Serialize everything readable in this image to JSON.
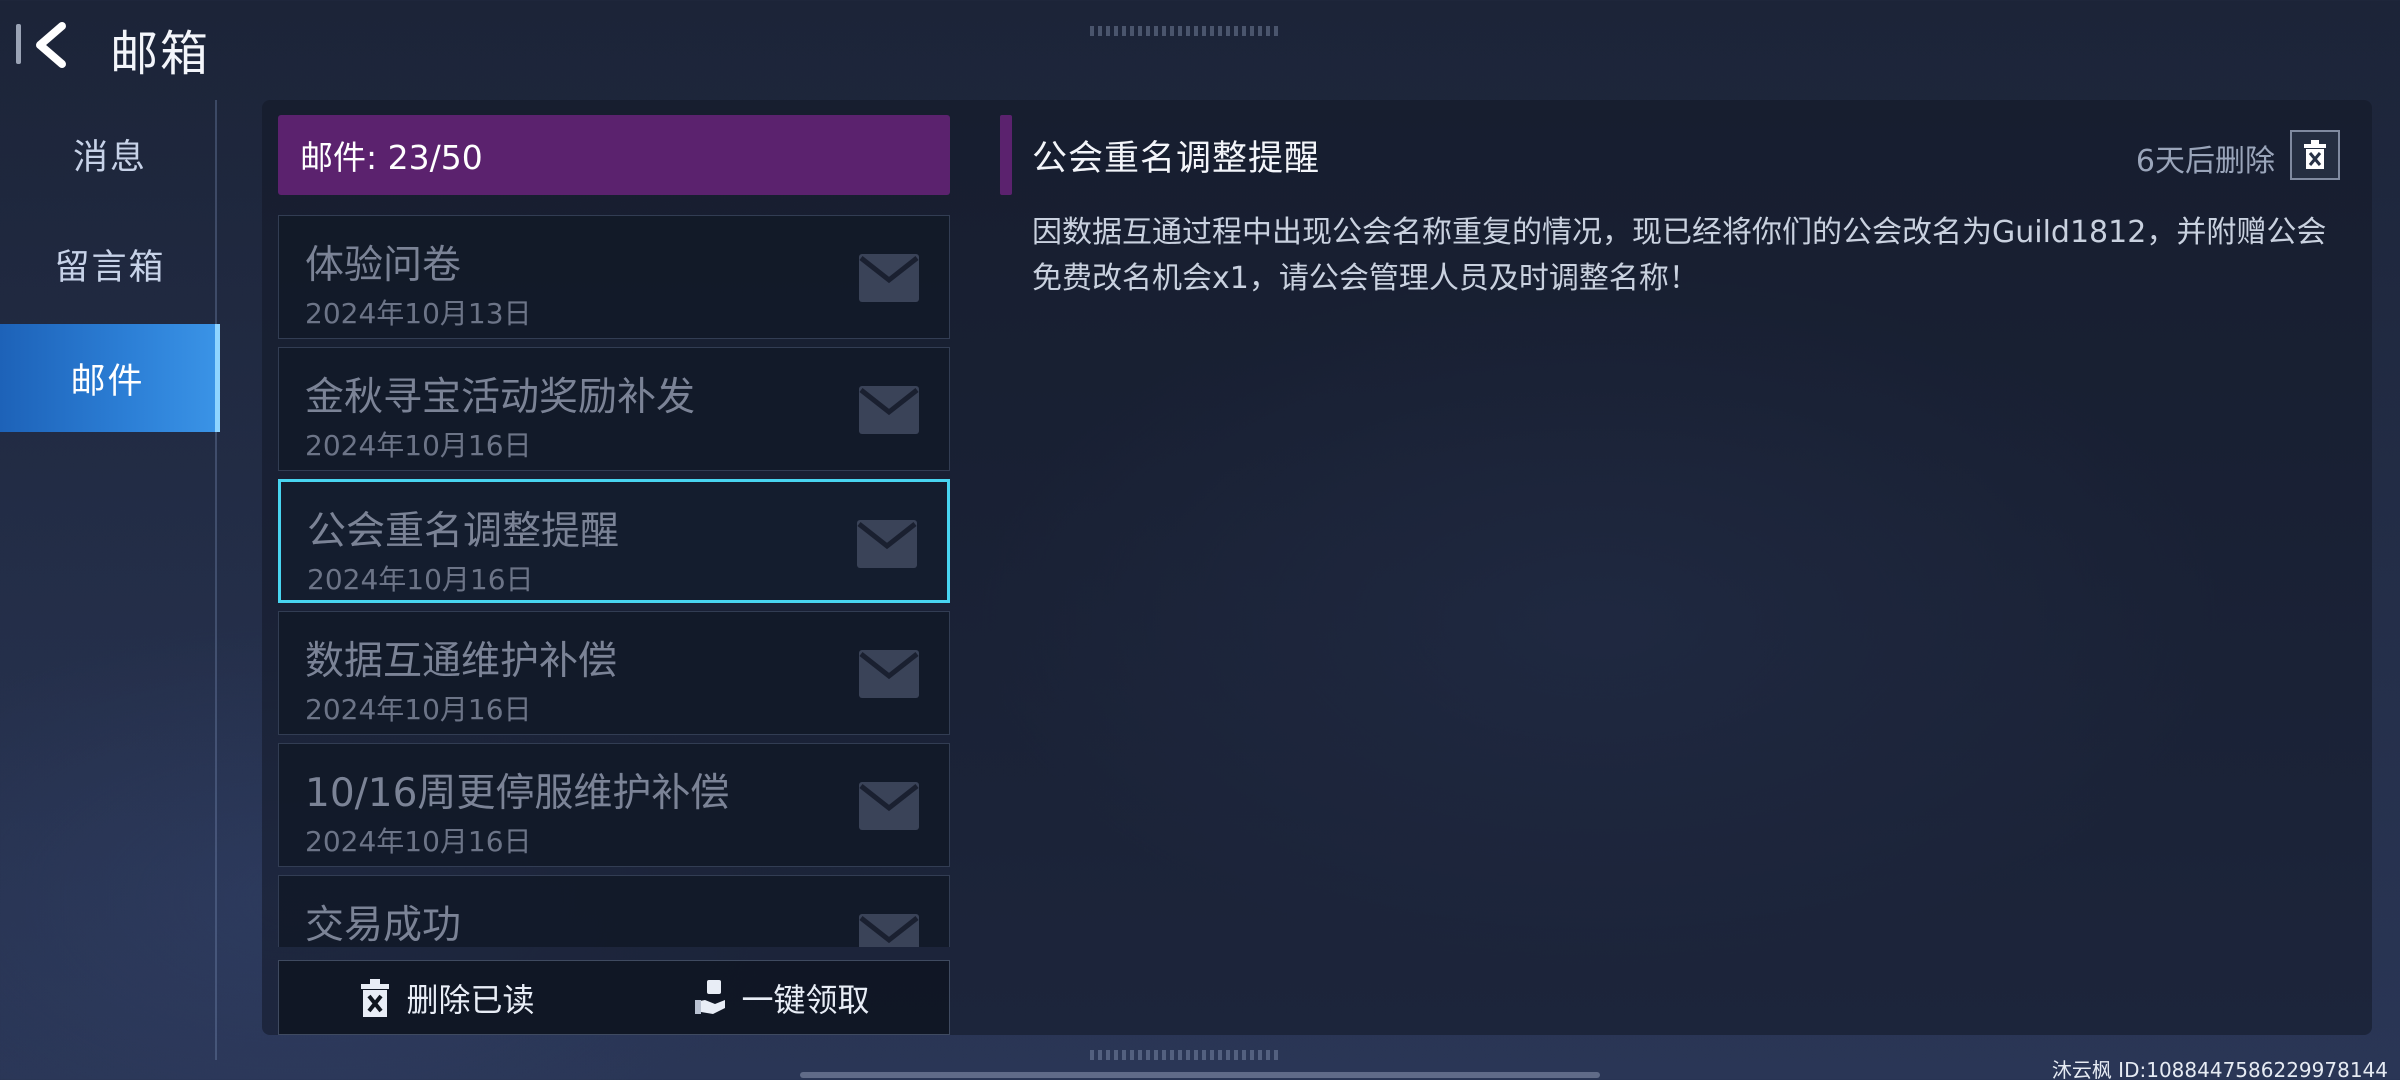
{
  "header": {
    "title": "邮箱",
    "back_icon": "chevron-left-icon"
  },
  "sidebar": {
    "items": [
      {
        "label": "消息",
        "active": false
      },
      {
        "label": "留言箱",
        "active": false
      },
      {
        "label": "邮件",
        "active": true
      }
    ]
  },
  "mail_list": {
    "count_label": "邮件: 23/50",
    "items": [
      {
        "subject": "体验问卷",
        "date": "2024年10月13日",
        "selected": false
      },
      {
        "subject": "金秋寻宝活动奖励补发",
        "date": "2024年10月16日",
        "selected": false
      },
      {
        "subject": "公会重名调整提醒",
        "date": "2024年10月16日",
        "selected": true
      },
      {
        "subject": "数据互通维护补偿",
        "date": "2024年10月16日",
        "selected": false
      },
      {
        "subject": "10/16周更停服维护补偿",
        "date": "2024年10月16日",
        "selected": false
      },
      {
        "subject": "交易成功",
        "date": "",
        "selected": false
      }
    ],
    "envelope_icon": "envelope-icon"
  },
  "actions": {
    "delete_read": {
      "label": "删除已读",
      "icon": "trash-icon"
    },
    "claim_all": {
      "label": "一键领取",
      "icon": "hand-receive-icon"
    }
  },
  "detail": {
    "title": "公会重名调整提醒",
    "expire_text": "6天后删除",
    "delete_icon": "trash-icon",
    "body": "因数据互通过程中出现公会名称重复的情况，现已经将你们的公会改名为Guild1812，并附赠公会免费改名机会x1，请公会管理人员及时调整名称！"
  },
  "footer": {
    "user_id": "沐云枫  ID:1088447586229978144"
  },
  "colors": {
    "accent_purple": "#5b226e",
    "active_blue": "#2c7fd6",
    "selected_cyan": "#48d4f0"
  }
}
